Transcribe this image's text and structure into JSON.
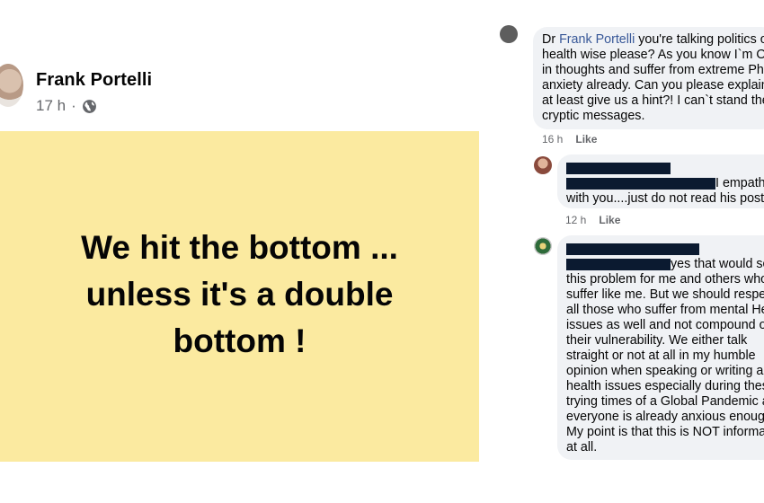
{
  "post": {
    "author": "Frank Portelli",
    "time": "17 h",
    "separator": "·",
    "privacy_icon": "globe-icon",
    "card_bg": "#fbeaa0",
    "text_lines": [
      "We hit the bottom ...",
      "unless it's a double",
      "bottom !"
    ]
  },
  "comments": [
    {
      "lines_prefix": "Dr ",
      "mention": "Frank Portelli",
      "lines_suffix": " you're talking politics o",
      "lines": [
        "health wise please?  As you know I`m OC",
        "in thoughts and suffer from extreme Pho",
        "anxiety already.  Can you please explain",
        "at least give us a hint?!  I can`t stand the",
        "cryptic messages."
      ],
      "time": "16 h",
      "like": "Like"
    },
    {
      "lines": [
        "I empathi",
        "with you....just do not read his posts"
      ],
      "time": "12 h",
      "like": "Like"
    },
    {
      "lines": [
        "yes that would so",
        "this problem for me and others who",
        "suffer like me.  But we should respec",
        "all those who suffer from mental Hea",
        "issues as well and not compound on",
        "their vulnerability.  We either talk",
        "straight or not at all in my humble",
        "opinion when speaking or writing ab",
        "health issues especially during these",
        "trying times of a Global Pandemic as",
        "everyone is already anxious enough",
        "My point is that this is NOT informat",
        "at all."
      ]
    }
  ],
  "colors": {
    "redaction": "#0b1a30",
    "bubble": "#f0f2f5",
    "mention": "#385898"
  }
}
